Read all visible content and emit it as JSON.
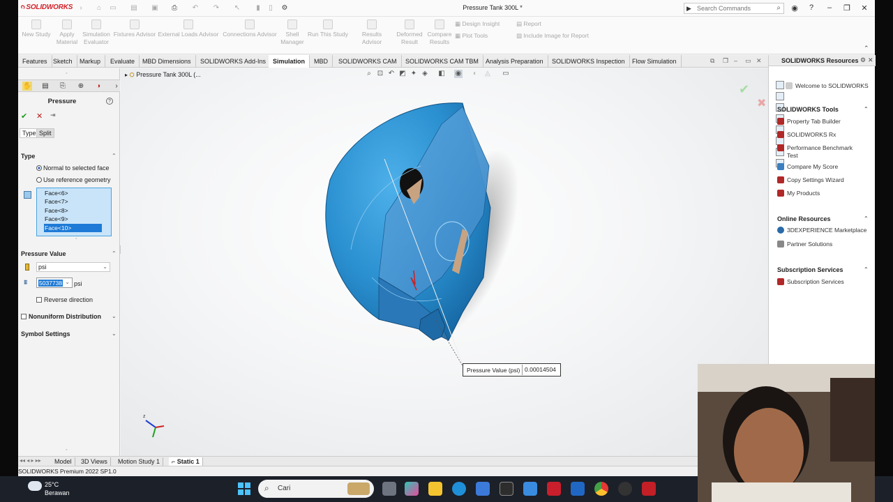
{
  "app": {
    "logo_text": "SOLIDWORKS",
    "document_title": "Pressure Tank 300L *",
    "search_placeholder": "Search Commands"
  },
  "command_manager": {
    "items": [
      "New Study",
      "Apply Material",
      "Simulation Evaluator",
      "Fixtures Advisor",
      "External Loads Advisor",
      "Connections Advisor",
      "Shell Manager",
      "Run This Study",
      "Results Advisor",
      "Deformed Result",
      "Compare Results"
    ],
    "small_items": [
      "Design Insight",
      "Plot Tools",
      "Report",
      "Include Image for Report"
    ]
  },
  "tabs": [
    "Features",
    "Sketch",
    "Markup",
    "Evaluate",
    "MBD Dimensions",
    "SOLIDWORKS Add-Ins",
    "Simulation",
    "MBD",
    "SOLIDWORKS CAM",
    "SOLIDWORKS CAM TBM",
    "Analysis Preparation",
    "SOLIDWORKS Inspection",
    "Flow Simulation"
  ],
  "active_tab": "Simulation",
  "property_manager": {
    "title": "Pressure",
    "subtabs": [
      "Type",
      "Split"
    ],
    "type_section": "Type",
    "radio_normal": "Normal to selected face",
    "radio_reference": "Use reference geometry",
    "faces": [
      "Face<6>",
      "Face<7>",
      "Face<8>",
      "Face<9>",
      "Face<10>"
    ],
    "pressure_value_section": "Pressure Value",
    "unit": "psi",
    "value": "5037738",
    "value_unit": "psi",
    "reverse_direction": "Reverse direction",
    "nonuniform": "Nonuniform Distribution",
    "symbol_settings": "Symbol Settings"
  },
  "graphics": {
    "breadcrumb": "Pressure Tank 300L (...",
    "callout_label": "Pressure Value (psi)",
    "callout_value": "0.00014504"
  },
  "task_pane": {
    "title": "SOLIDWORKS Resources",
    "welcome": "Welcome to SOLIDWORKS",
    "tools_header": "SOLIDWORKS Tools",
    "tools": [
      "Property Tab Builder",
      "SOLIDWORKS Rx",
      "Performance Benchmark",
      "Test",
      "Compare My Score",
      "Copy Settings Wizard",
      "My Products"
    ],
    "online_header": "Online Resources",
    "online": [
      "3DEXPERIENCE Marketplace",
      "Partner Solutions"
    ],
    "subscription_header": "Subscription Services",
    "subscription": [
      "Subscription Services"
    ]
  },
  "bottom_tabs": [
    "Model",
    "3D Views",
    "Motion Study 1",
    "Static 1"
  ],
  "status_bar": "SOLIDWORKS Premium 2022 SP1.0",
  "taskbar": {
    "temperature": "25°C",
    "weather": "Berawan",
    "search": "Cari"
  },
  "colors": {
    "model_blue": "#2f8fd0",
    "selection_blue": "#1e7ad6",
    "brand_red": "#d2232a"
  }
}
